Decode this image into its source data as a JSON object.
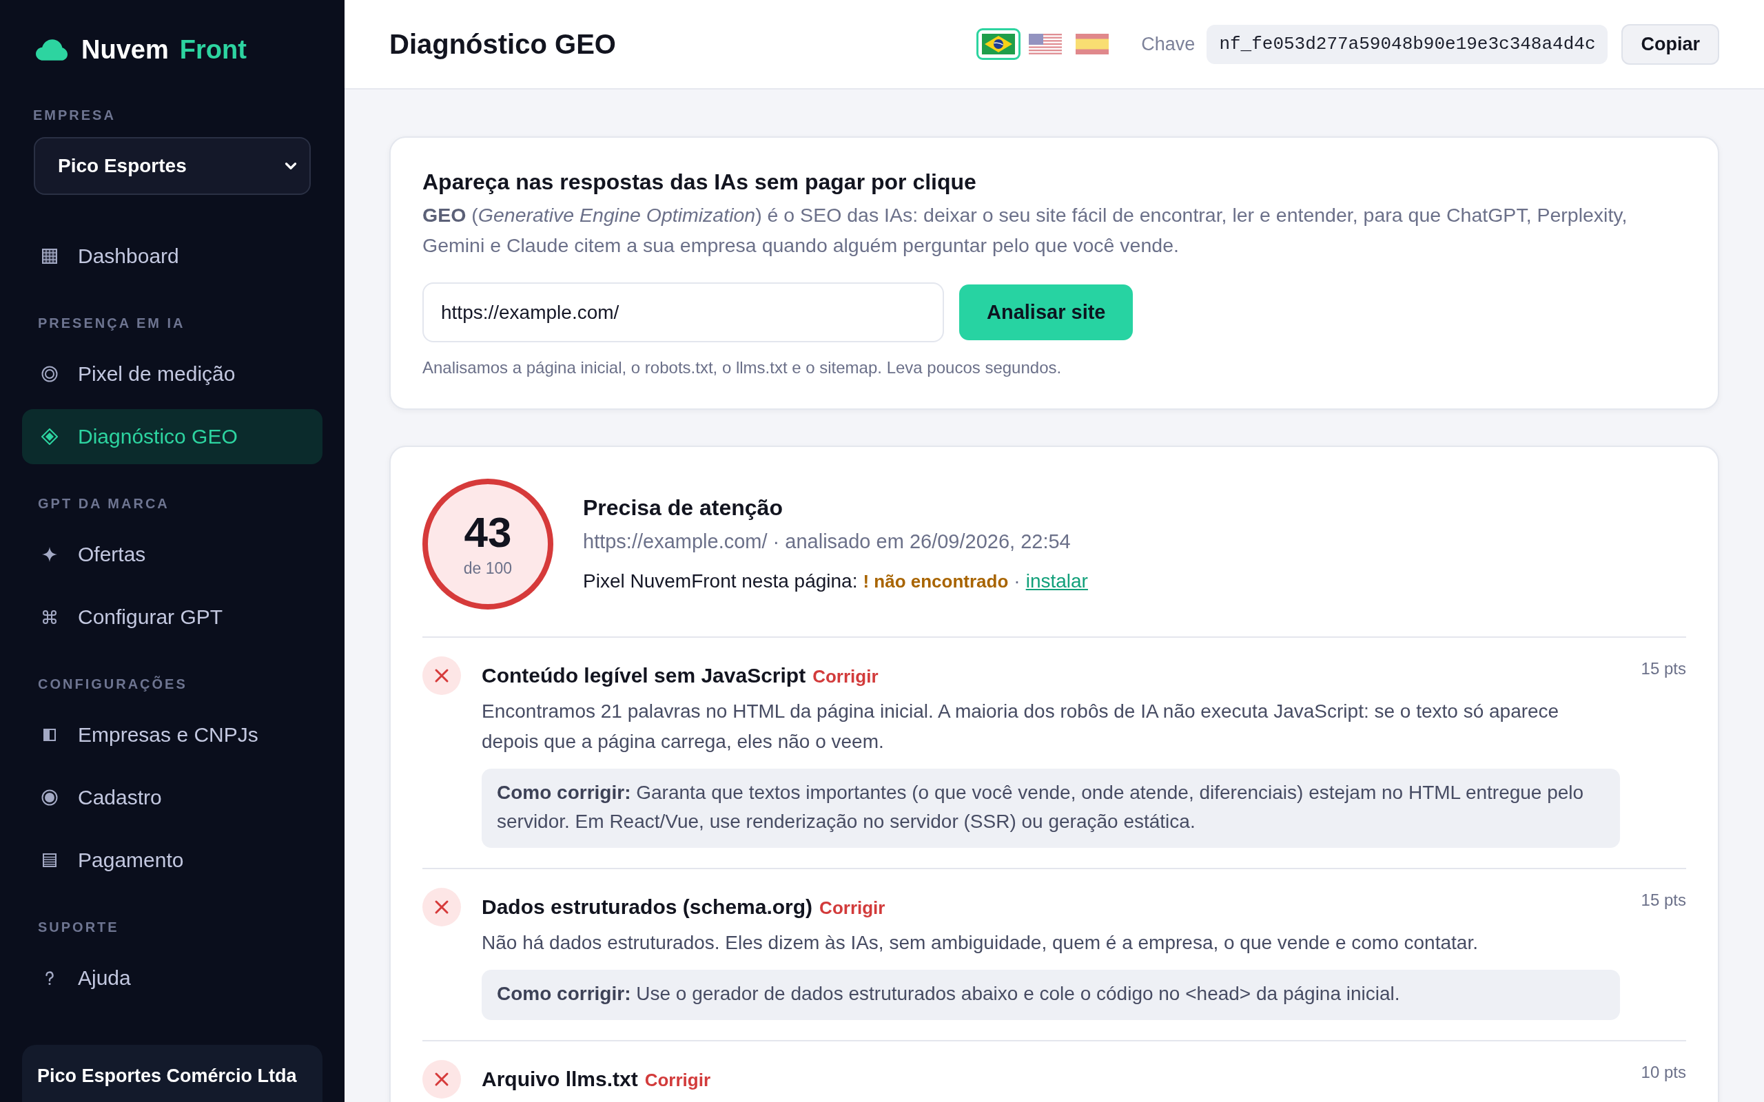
{
  "sidebar": {
    "logo": {
      "word_1": "Nuvem",
      "word_2": "Front"
    },
    "company_label": "EMPRESA",
    "company_select": {
      "value": "Pico Esportes"
    },
    "sections": [
      {
        "items": [
          {
            "kind": "grid",
            "label": "Dashboard",
            "selected": false
          }
        ]
      },
      {
        "label": "PRESENÇA EM IA",
        "items": [
          {
            "kind": "target",
            "label": "Pixel de medição",
            "selected": false
          },
          {
            "kind": "diamond",
            "label": "Diagnóstico GEO",
            "selected": true
          }
        ]
      },
      {
        "label": "GPT DA MARCA",
        "items": [
          {
            "kind": "sparkle",
            "label": "Ofertas",
            "selected": false
          },
          {
            "kind": "command",
            "label": "Configurar GPT",
            "selected": false
          }
        ]
      },
      {
        "label": "CONFIGURAÇÕES",
        "items": [
          {
            "kind": "half-square",
            "label": "Empresas e CNPJs",
            "selected": false
          },
          {
            "kind": "radio",
            "label": "Cadastro",
            "selected": false
          },
          {
            "kind": "list",
            "label": "Pagamento",
            "selected": false
          }
        ]
      },
      {
        "label": "SUPORTE",
        "items": [
          {
            "kind": "help",
            "label": "Ajuda",
            "selected": false
          }
        ]
      }
    ],
    "account_card": {
      "name": "Pico Esportes Comércio Ltda"
    }
  },
  "header": {
    "title": "Diagnóstico GEO",
    "languages": [
      {
        "kind": "brazil",
        "selected": true
      },
      {
        "kind": "usa",
        "selected": false
      },
      {
        "kind": "spain",
        "selected": false
      }
    ],
    "key_label": "Chave",
    "key_value": "nf_fe053d277a59048b90e19e3c348a4d4c",
    "copy_button": "Copiar"
  },
  "intro_card": {
    "title": "Apareça nas respostas das IAs sem pagar por clique",
    "text": "**GEO** (*Generative Engine Optimization*) é o SEO das IAs: deixar o seu site fácil de encontrar, ler e entender, para que ChatGPT, Perplexity, Gemini e Claude citem a sua empresa quando alguém perguntar pelo que você vende.",
    "url_field": {
      "value": "https://example.com/"
    },
    "analyze_button": "Analisar site",
    "hint": "Analisamos a página inicial, o robots.txt, o llms.txt e o sitemap. Leva poucos segundos."
  },
  "result_card": {
    "score": {
      "value": "43",
      "max": "de 100"
    },
    "verdict": "Precisa de atenção",
    "meta": "https://example.com/ · analisado em 26/09/2026, 22:54",
    "pixel": {
      "label": "Pixel NuvemFront nesta página:",
      "found": false,
      "status": "! não encontrado",
      "separator": "·",
      "link": "instalar"
    },
    "checks": [
      {
        "passed": false,
        "title": "Conteúdo legível sem JavaScript",
        "status": "Corrigir",
        "points": "15 pts",
        "description": "Encontramos 21 palavras no HTML da página inicial. A maioria dos robôs de IA não executa JavaScript: se o texto só aparece depois que a página carrega, eles não o veem.",
        "fix": "**Como corrigir:** Garanta que textos importantes (o que você vende, onde atende, diferenciais) estejam no HTML entregue pelo servidor. Em React/Vue, use renderização no servidor (SSR) ou geração estática."
      },
      {
        "passed": false,
        "title": "Dados estruturados (schema.org)",
        "status": "Corrigir",
        "points": "15 pts",
        "description": "Não há dados estruturados. Eles dizem às IAs, sem ambiguidade, quem é a empresa, o que vende e como contatar.",
        "fix": "**Como corrigir:** Use o gerador de dados estruturados abaixo e cole o código no <head> da página inicial."
      },
      {
        "passed": false,
        "title": "Arquivo llms.txt",
        "status": "Corrigir",
        "points": "10 pts"
      }
    ]
  }
}
